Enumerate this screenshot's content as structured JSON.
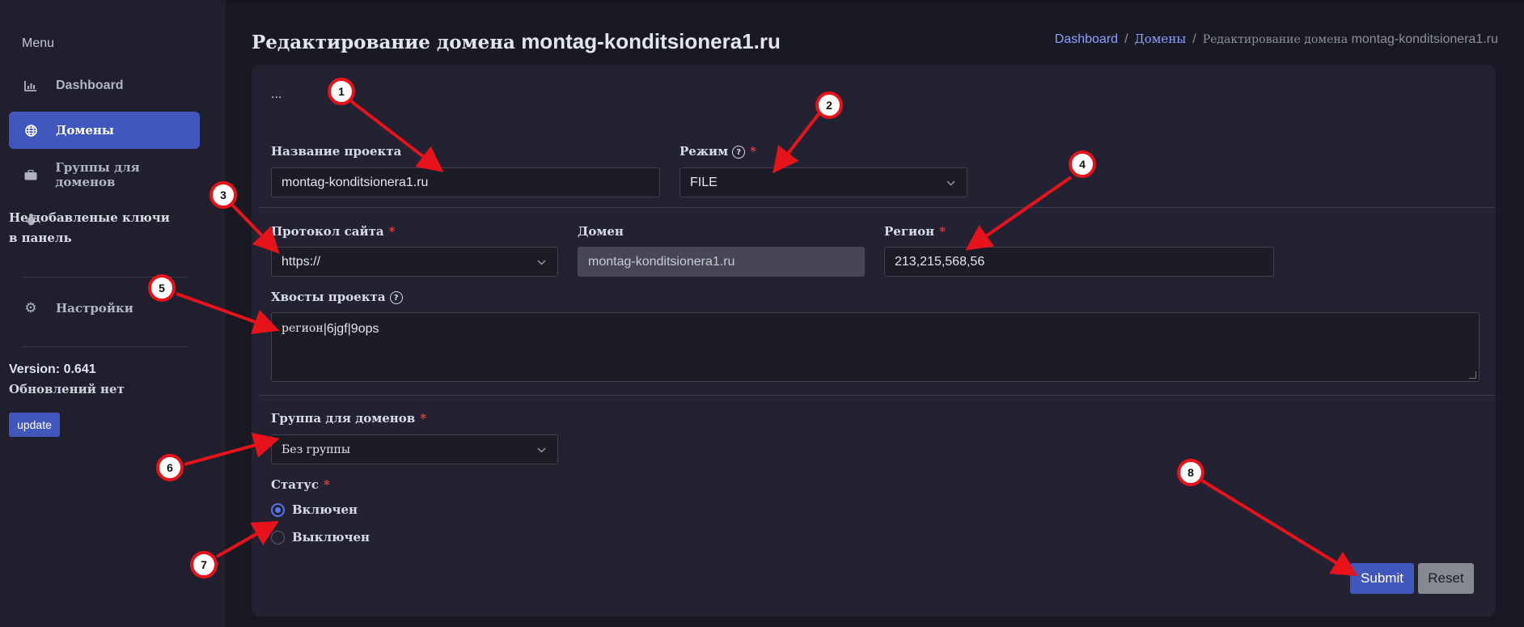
{
  "sidebar": {
    "menu_title": "Menu",
    "items": [
      {
        "label": "Dashboard",
        "icon": "chart-icon"
      },
      {
        "label": "Домены",
        "icon": "globe-icon"
      },
      {
        "label": "Группы для доменов",
        "icon": "briefcase-icon"
      },
      {
        "label_line1": "Не добавленые ключи",
        "label_line2": "в панель",
        "icon": "bug-icon"
      },
      {
        "label": "Настройки",
        "icon": "gear-icon"
      }
    ],
    "version": "Version: 0.641",
    "updates_text": "Обновлений нет",
    "update_button": "update"
  },
  "header": {
    "title_prefix": "Редактирование домена",
    "title_domain": "montag-konditsionera1.ru",
    "breadcrumb": {
      "dashboard": "Dashboard",
      "domains": "Домены",
      "current_prefix": "Редактирование домена",
      "current_domain": "montag-konditsionera1.ru",
      "separator": "/"
    }
  },
  "form": {
    "ellipsis": "...",
    "project_name": {
      "label": "Название проекта",
      "value": "montag-konditsionera1.ru"
    },
    "mode": {
      "label": "Режим",
      "value": "FILE",
      "required": "*",
      "help": "?"
    },
    "protocol": {
      "label": "Протокол сайта",
      "value": "https://",
      "required": "*"
    },
    "domain": {
      "label": "Домен",
      "value": "montag-konditsionera1.ru"
    },
    "region": {
      "label": "Регион",
      "value": "213,215,568,56",
      "required": "*"
    },
    "tails": {
      "label": "Хвосты проекта",
      "value_prefix": "регион",
      "value_rest": "|6jgf|9ops",
      "help": "?"
    },
    "group": {
      "label": "Группа для доменов",
      "value": "Без группы",
      "required": "*"
    },
    "status": {
      "label": "Статус",
      "required": "*",
      "options": [
        "Включен",
        "Выключен"
      ],
      "selected": "Включен"
    },
    "submit": "Submit",
    "reset": "Reset"
  },
  "annotations": {
    "markers": [
      "1",
      "2",
      "3",
      "4",
      "5",
      "6",
      "7",
      "8"
    ],
    "arrow_color": "#e8121a"
  },
  "colors": {
    "accent": "#4257bd",
    "required": "#ee3b3b",
    "background": "#191923",
    "card": "#222233"
  }
}
